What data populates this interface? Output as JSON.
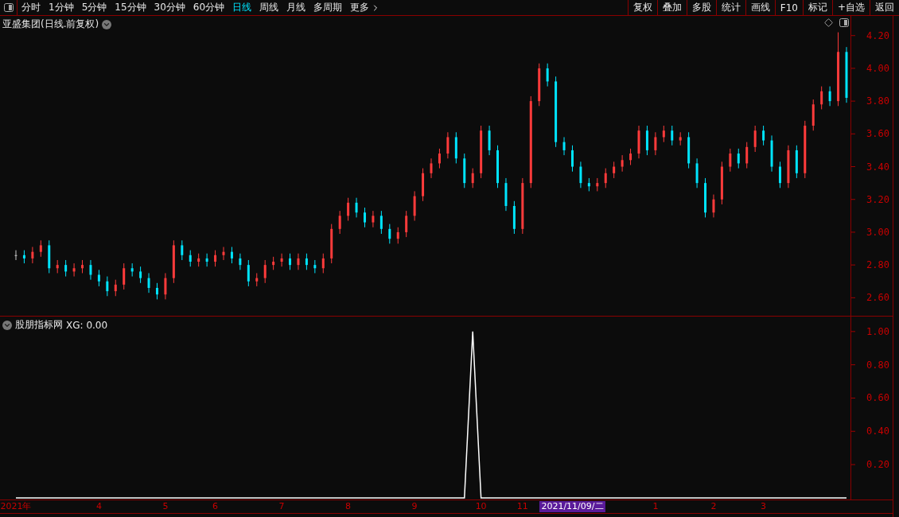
{
  "toolbar": {
    "tabs": [
      {
        "label": "分时",
        "selected": false
      },
      {
        "label": "1分钟",
        "selected": false
      },
      {
        "label": "5分钟",
        "selected": false
      },
      {
        "label": "15分钟",
        "selected": false
      },
      {
        "label": "30分钟",
        "selected": false
      },
      {
        "label": "60分钟",
        "selected": false
      },
      {
        "label": "日线",
        "selected": true
      },
      {
        "label": "周线",
        "selected": false
      },
      {
        "label": "月线",
        "selected": false
      },
      {
        "label": "多周期",
        "selected": false
      },
      {
        "label": "更多",
        "selected": false
      }
    ],
    "buttons": [
      "复权",
      "叠加",
      "多股",
      "统计",
      "画线",
      "F10",
      "标记",
      "+自选",
      "返回"
    ]
  },
  "price_panel": {
    "title": "亚盛集团(日线.前复权)",
    "chart_data": {
      "type": "candlestick",
      "ylim": [
        2.49,
        4.32
      ],
      "yticks": [
        {
          "value": 2.6,
          "label": "2.60"
        },
        {
          "value": 2.8,
          "label": "2.80"
        },
        {
          "value": 3.0,
          "label": "3.00"
        },
        {
          "value": 3.2,
          "label": "3.20"
        },
        {
          "value": 3.4,
          "label": "3.40"
        },
        {
          "value": 3.6,
          "label": "3.60"
        },
        {
          "value": 3.8,
          "label": "3.80"
        },
        {
          "value": 4.0,
          "label": "4.00"
        },
        {
          "value": 4.2,
          "label": "4.20"
        }
      ],
      "categories": [
        null,
        null,
        null,
        null,
        null,
        null,
        null,
        null,
        null,
        null,
        null,
        null,
        null,
        null,
        null,
        null,
        null,
        null,
        null,
        null,
        null,
        null,
        null,
        null,
        null,
        null,
        null,
        null,
        null,
        null,
        null,
        null,
        null,
        null,
        null,
        null,
        null,
        null,
        null,
        null,
        null,
        null,
        null,
        null,
        null,
        null,
        null,
        null,
        null,
        null,
        null,
        null,
        null,
        null,
        null,
        null,
        null,
        null,
        null,
        null,
        null,
        null,
        null,
        null,
        null,
        null,
        null,
        null,
        null,
        null,
        null,
        null,
        null,
        null,
        null,
        null,
        null,
        null,
        null,
        null,
        null,
        null,
        null,
        null,
        null,
        null,
        null,
        null,
        null,
        null,
        null,
        null,
        null,
        null,
        null,
        null,
        null,
        null,
        null,
        null,
        null
      ],
      "ohlc": [
        [
          2.86,
          2.89,
          2.83,
          2.86
        ],
        [
          2.86,
          2.89,
          2.81,
          2.84
        ],
        [
          2.84,
          2.91,
          2.81,
          2.88
        ],
        [
          2.88,
          2.95,
          2.85,
          2.92
        ],
        [
          2.92,
          2.95,
          2.75,
          2.78
        ],
        [
          2.78,
          2.83,
          2.75,
          2.8
        ],
        [
          2.8,
          2.83,
          2.73,
          2.76
        ],
        [
          2.76,
          2.81,
          2.73,
          2.78
        ],
        [
          2.78,
          2.83,
          2.75,
          2.8
        ],
        [
          2.8,
          2.83,
          2.71,
          2.74
        ],
        [
          2.74,
          2.77,
          2.67,
          2.7
        ],
        [
          2.7,
          2.73,
          2.61,
          2.64
        ],
        [
          2.64,
          2.71,
          2.61,
          2.68
        ],
        [
          2.68,
          2.81,
          2.65,
          2.78
        ],
        [
          2.78,
          2.81,
          2.73,
          2.76
        ],
        [
          2.76,
          2.79,
          2.69,
          2.72
        ],
        [
          2.72,
          2.75,
          2.63,
          2.66
        ],
        [
          2.66,
          2.69,
          2.59,
          2.62
        ],
        [
          2.62,
          2.75,
          2.59,
          2.72
        ],
        [
          2.72,
          2.95,
          2.69,
          2.92
        ],
        [
          2.92,
          2.95,
          2.83,
          2.86
        ],
        [
          2.86,
          2.89,
          2.79,
          2.82
        ],
        [
          2.82,
          2.87,
          2.79,
          2.84
        ],
        [
          2.84,
          2.87,
          2.79,
          2.82
        ],
        [
          2.82,
          2.89,
          2.79,
          2.86
        ],
        [
          2.86,
          2.91,
          2.83,
          2.88
        ],
        [
          2.88,
          2.91,
          2.81,
          2.84
        ],
        [
          2.84,
          2.87,
          2.77,
          2.8
        ],
        [
          2.8,
          2.83,
          2.67,
          2.7
        ],
        [
          2.7,
          2.75,
          2.67,
          2.72
        ],
        [
          2.72,
          2.83,
          2.69,
          2.8
        ],
        [
          2.8,
          2.85,
          2.77,
          2.82
        ],
        [
          2.82,
          2.87,
          2.79,
          2.84
        ],
        [
          2.84,
          2.87,
          2.77,
          2.8
        ],
        [
          2.8,
          2.87,
          2.77,
          2.84
        ],
        [
          2.84,
          2.87,
          2.77,
          2.8
        ],
        [
          2.8,
          2.83,
          2.75,
          2.78
        ],
        [
          2.78,
          2.87,
          2.75,
          2.84
        ],
        [
          2.84,
          3.05,
          2.81,
          3.02
        ],
        [
          3.02,
          3.13,
          2.99,
          3.1
        ],
        [
          3.1,
          3.21,
          3.07,
          3.18
        ],
        [
          3.18,
          3.21,
          3.09,
          3.12
        ],
        [
          3.12,
          3.15,
          3.03,
          3.06
        ],
        [
          3.06,
          3.13,
          3.03,
          3.1
        ],
        [
          3.1,
          3.13,
          2.99,
          3.02
        ],
        [
          3.02,
          3.05,
          2.93,
          2.96
        ],
        [
          2.96,
          3.03,
          2.93,
          3.0
        ],
        [
          3.0,
          3.13,
          2.97,
          3.1
        ],
        [
          3.1,
          3.25,
          3.07,
          3.22
        ],
        [
          3.22,
          3.39,
          3.19,
          3.36
        ],
        [
          3.36,
          3.45,
          3.33,
          3.42
        ],
        [
          3.42,
          3.51,
          3.39,
          3.48
        ],
        [
          3.48,
          3.61,
          3.45,
          3.58
        ],
        [
          3.58,
          3.61,
          3.42,
          3.45
        ],
        [
          3.45,
          3.48,
          3.27,
          3.3
        ],
        [
          3.3,
          3.39,
          3.27,
          3.36
        ],
        [
          3.36,
          3.65,
          3.33,
          3.62
        ],
        [
          3.62,
          3.65,
          3.47,
          3.5
        ],
        [
          3.5,
          3.53,
          3.27,
          3.3
        ],
        [
          3.3,
          3.33,
          3.13,
          3.16
        ],
        [
          3.16,
          3.19,
          2.99,
          3.02
        ],
        [
          3.02,
          3.33,
          2.99,
          3.3
        ],
        [
          3.3,
          3.83,
          3.27,
          3.8
        ],
        [
          3.8,
          4.03,
          3.77,
          4.0
        ],
        [
          4.0,
          4.03,
          3.89,
          3.92
        ],
        [
          3.92,
          3.95,
          3.52,
          3.55
        ],
        [
          3.55,
          3.58,
          3.47,
          3.5
        ],
        [
          3.5,
          3.53,
          3.37,
          3.4
        ],
        [
          3.4,
          3.43,
          3.27,
          3.3
        ],
        [
          3.3,
          3.33,
          3.25,
          3.28
        ],
        [
          3.28,
          3.33,
          3.25,
          3.3
        ],
        [
          3.3,
          3.39,
          3.27,
          3.36
        ],
        [
          3.36,
          3.43,
          3.33,
          3.4
        ],
        [
          3.4,
          3.47,
          3.37,
          3.44
        ],
        [
          3.44,
          3.51,
          3.41,
          3.48
        ],
        [
          3.48,
          3.65,
          3.45,
          3.62
        ],
        [
          3.62,
          3.65,
          3.47,
          3.5
        ],
        [
          3.5,
          3.61,
          3.47,
          3.58
        ],
        [
          3.58,
          3.65,
          3.55,
          3.62
        ],
        [
          3.62,
          3.65,
          3.53,
          3.56
        ],
        [
          3.56,
          3.61,
          3.53,
          3.58
        ],
        [
          3.58,
          3.61,
          3.39,
          3.42
        ],
        [
          3.42,
          3.45,
          3.27,
          3.3
        ],
        [
          3.3,
          3.33,
          3.09,
          3.12
        ],
        [
          3.12,
          3.23,
          3.09,
          3.2
        ],
        [
          3.2,
          3.43,
          3.17,
          3.4
        ],
        [
          3.4,
          3.51,
          3.37,
          3.48
        ],
        [
          3.48,
          3.51,
          3.39,
          3.42
        ],
        [
          3.42,
          3.55,
          3.39,
          3.52
        ],
        [
          3.52,
          3.65,
          3.49,
          3.62
        ],
        [
          3.62,
          3.65,
          3.53,
          3.56
        ],
        [
          3.56,
          3.59,
          3.37,
          3.4
        ],
        [
          3.4,
          3.43,
          3.27,
          3.3
        ],
        [
          3.3,
          3.53,
          3.27,
          3.5
        ],
        [
          3.5,
          3.53,
          3.33,
          3.36
        ],
        [
          3.36,
          3.68,
          3.33,
          3.65
        ],
        [
          3.65,
          3.81,
          3.62,
          3.78
        ],
        [
          3.78,
          3.89,
          3.75,
          3.86
        ],
        [
          3.86,
          3.89,
          3.77,
          3.8
        ],
        [
          3.8,
          4.22,
          3.77,
          4.1
        ],
        [
          4.1,
          4.13,
          3.79,
          3.82
        ]
      ]
    }
  },
  "indicator_panel": {
    "title": "股朋指标网",
    "readout": "XG: 0.00",
    "chart_data": {
      "type": "line",
      "ylim": [
        -0.01,
        1.09
      ],
      "yticks": [
        {
          "value": 0.2,
          "label": "0.20"
        },
        {
          "value": 0.4,
          "label": "0.40"
        },
        {
          "value": 0.6,
          "label": "0.60"
        },
        {
          "value": 0.8,
          "label": "0.80"
        },
        {
          "value": 1.0,
          "label": "1.00"
        }
      ],
      "categories": [
        "2021年",
        null,
        null,
        null,
        null,
        null,
        null,
        null,
        null,
        null,
        "4",
        null,
        null,
        null,
        null,
        null,
        null,
        null,
        "5",
        null,
        null,
        null,
        null,
        null,
        "6",
        null,
        null,
        null,
        null,
        null,
        null,
        null,
        "7",
        null,
        null,
        null,
        null,
        null,
        null,
        null,
        "8",
        null,
        null,
        null,
        null,
        null,
        null,
        null,
        "9",
        null,
        null,
        null,
        null,
        null,
        null,
        null,
        "10",
        null,
        null,
        null,
        null,
        "11",
        null,
        null,
        null,
        null,
        null,
        "2021/11/09/二",
        null,
        null,
        null,
        null,
        null,
        null,
        null,
        null,
        null,
        "1",
        null,
        null,
        null,
        null,
        null,
        null,
        "2",
        null,
        null,
        null,
        null,
        null,
        "3",
        null,
        null,
        null,
        null,
        null,
        null,
        null,
        null,
        null,
        null
      ],
      "series": [
        {
          "color": "#ffffff",
          "values": [
            0,
            0,
            0,
            0,
            0,
            0,
            0,
            0,
            0,
            0,
            0,
            0,
            0,
            0,
            0,
            0,
            0,
            0,
            0,
            0,
            0,
            0,
            0,
            0,
            0,
            0,
            0,
            0,
            0,
            0,
            0,
            0,
            0,
            0,
            0,
            0,
            0,
            0,
            0,
            0,
            0,
            0,
            0,
            0,
            0,
            0,
            0,
            0,
            0,
            0,
            0,
            0,
            0,
            0,
            0,
            1,
            0,
            0,
            0,
            0,
            0,
            0,
            0,
            0,
            0,
            0,
            0,
            0,
            0,
            0,
            0,
            0,
            0,
            0,
            0,
            0,
            0,
            0,
            0,
            0,
            0,
            0,
            0,
            0,
            0,
            0,
            0,
            0,
            0,
            0,
            0,
            0,
            0,
            0,
            0,
            0,
            0,
            0,
            0,
            0,
            0
          ]
        }
      ]
    }
  }
}
